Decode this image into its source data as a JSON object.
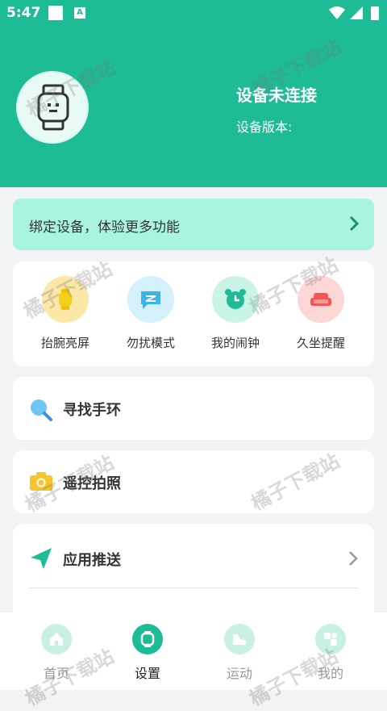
{
  "status_bar": {
    "time": "5:47",
    "a_badge": "A"
  },
  "header": {
    "device_title": "设备未连接",
    "device_version_label": "设备版本:"
  },
  "bind_card": {
    "text": "绑定设备，体验更多功能"
  },
  "features": [
    {
      "label": "抬腕亮屏",
      "icon": "watch-icon",
      "color": "#fbe7a6"
    },
    {
      "label": "勿扰模式",
      "icon": "message-icon",
      "color": "#d4f0fb"
    },
    {
      "label": "我的闹钟",
      "icon": "alarm-clock-icon",
      "color": "#c9f5e8"
    },
    {
      "label": "久坐提醒",
      "icon": "sofa-icon",
      "color": "#fdd6d6"
    }
  ],
  "rows": {
    "find_band": "寻找手环",
    "remote_photo": "遥控拍照",
    "app_push": "应用推送"
  },
  "watermark": "橘子下载站",
  "bottom_nav": [
    {
      "label": "首页",
      "icon": "home-icon"
    },
    {
      "label": "设置",
      "icon": "watch-icon",
      "active": true
    },
    {
      "label": "运动",
      "icon": "shoe-icon"
    },
    {
      "label": "我的",
      "icon": "profile-icon"
    }
  ],
  "colors": {
    "primary": "#1dbb96",
    "bind_bg": "#a8f4e0",
    "page_bg": "#f2f3f5"
  }
}
